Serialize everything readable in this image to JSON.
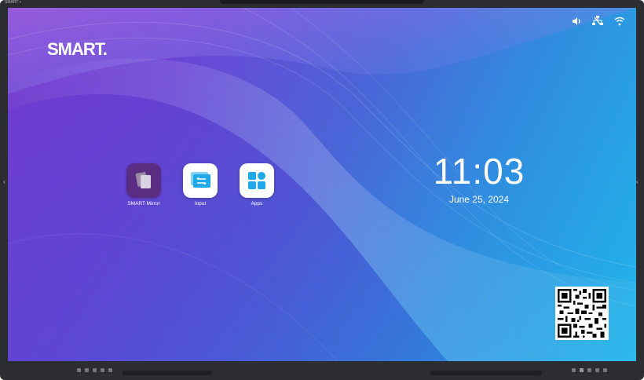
{
  "device": {
    "label": "SMART ▪"
  },
  "brand": {
    "logo_text": "SMART."
  },
  "status_bar": {
    "icons": [
      "volume-icon",
      "network-icon",
      "wifi-icon"
    ]
  },
  "apps": [
    {
      "label": "SMART Mirror",
      "icon": "mirror-icon",
      "color": "#5a2c82"
    },
    {
      "label": "Input",
      "icon": "input-icon",
      "color": "#ffffff"
    },
    {
      "label": "Apps",
      "icon": "apps-grid-icon",
      "color": "#ffffff"
    }
  ],
  "clock": {
    "time": "11:03",
    "date": "June 25, 2024"
  },
  "colors": {
    "accent": "#1fa9e8",
    "purple": "#7a3fcf"
  }
}
